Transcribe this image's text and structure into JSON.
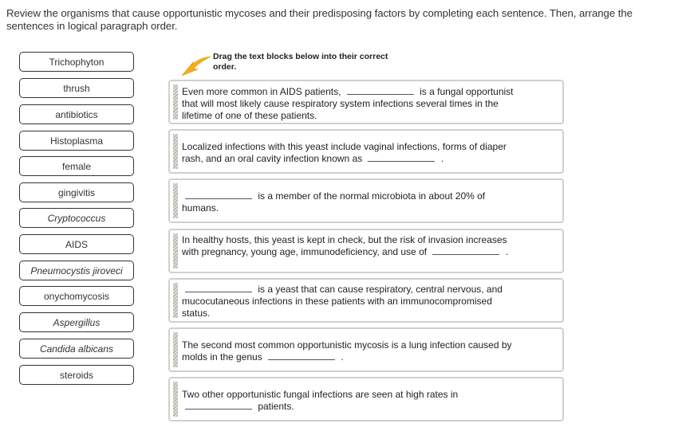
{
  "instructions": "Review the organisms that cause opportunistic mycoses and their predisposing factors by completing each sentence. Then, arrange the sentences in logical paragraph order.",
  "hint": {
    "text": "Drag the text blocks below into their correct order.",
    "icon": "arrow-down-left-icon",
    "arrow_color": "#f2ae1c"
  },
  "word_bank": [
    {
      "label": "Trichophyton",
      "italic": false
    },
    {
      "label": "thrush",
      "italic": false
    },
    {
      "label": "antibiotics",
      "italic": false
    },
    {
      "label": "Histoplasma",
      "italic": false
    },
    {
      "label": "female",
      "italic": false
    },
    {
      "label": "gingivitis",
      "italic": false
    },
    {
      "label": "Cryptococcus",
      "italic": true
    },
    {
      "label": "AIDS",
      "italic": false
    },
    {
      "label": "Pneumocystis jiroveci",
      "italic": true
    },
    {
      "label": "onychomycosis",
      "italic": false
    },
    {
      "label": "Aspergillus",
      "italic": true
    },
    {
      "label": "Candida albicans",
      "italic": true
    },
    {
      "label": "steroids",
      "italic": false
    }
  ],
  "blocks": [
    {
      "before": "Even more common in AIDS patients,",
      "after": "is a fungal opportunist that will most likely cause respiratory system infections several times in the lifetime of one of these patients."
    },
    {
      "before": "Localized infections with this yeast include vaginal infections, forms of diaper rash, and an oral cavity infection known as",
      "after": "."
    },
    {
      "before": "",
      "after": "is a member of the normal microbiota in about 20% of humans."
    },
    {
      "before": "In healthy hosts, this yeast is kept in check, but the risk of invasion increases with pregnancy, young age, immunodeficiency, and use of",
      "after": "."
    },
    {
      "before": "",
      "after": "is a yeast that can cause respiratory, central nervous, and mucocutaneous infections in these patients with an immunocompromised status."
    },
    {
      "before": "The second most common opportunistic mycosis is a lung infection caused by molds in the genus",
      "after": "."
    },
    {
      "before": "Two other opportunistic fungal infections are seen at high rates in",
      "after": "patients."
    }
  ]
}
